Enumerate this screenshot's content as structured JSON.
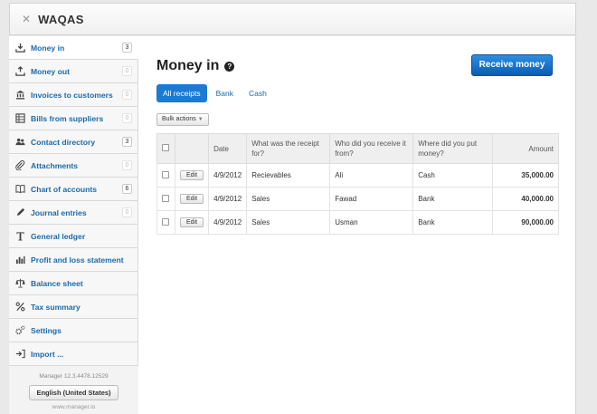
{
  "header": {
    "title": "WAQAS"
  },
  "sidebar": {
    "items": [
      {
        "label": "Money in",
        "count": "3",
        "icon": "download-tray-icon",
        "active": true
      },
      {
        "label": "Money out",
        "count": "0",
        "icon": "upload-tray-icon"
      },
      {
        "label": "Invoices to customers",
        "count": "0",
        "icon": "bank-icon"
      },
      {
        "label": "Bills from suppliers",
        "count": "0",
        "icon": "spreadsheet-icon"
      },
      {
        "label": "Contact directory",
        "count": "3",
        "icon": "people-icon"
      },
      {
        "label": "Attachments",
        "count": "0",
        "icon": "paperclip-icon"
      },
      {
        "label": "Chart of accounts",
        "count": "6",
        "icon": "book-icon"
      },
      {
        "label": "Journal entries",
        "count": "0",
        "icon": "pencil-icon"
      },
      {
        "label": "General ledger",
        "count": "",
        "icon": "letter-t-icon"
      },
      {
        "label": "Profit and loss statement",
        "count": "",
        "icon": "bar-chart-icon"
      },
      {
        "label": "Balance sheet",
        "count": "",
        "icon": "scale-icon"
      },
      {
        "label": "Tax summary",
        "count": "",
        "icon": "percent-icon"
      },
      {
        "label": "Settings",
        "count": "",
        "icon": "gears-icon"
      },
      {
        "label": "Import ...",
        "count": "",
        "icon": "import-icon"
      }
    ],
    "version": "Manager 12.3.4478.12529",
    "language": "English (United States)",
    "site": "www.manager.io"
  },
  "main": {
    "title": "Money in",
    "receive_label": "Receive money",
    "tabs": [
      {
        "label": "All receipts",
        "active": true
      },
      {
        "label": "Bank"
      },
      {
        "label": "Cash"
      }
    ],
    "bulk_label": "Bulk actions",
    "columns": {
      "date": "Date",
      "receipt_for": "What was the receipt for?",
      "received_from": "Who did you receive it from?",
      "put_money": "Where did you put money?",
      "amount": "Amount"
    },
    "edit_label": "Edit",
    "rows": [
      {
        "date": "4/9/2012",
        "for": "Recievables",
        "from": "Ali",
        "where": "Cash",
        "amount": "35,000.00"
      },
      {
        "date": "4/9/2012",
        "for": "Sales",
        "from": "Fawad",
        "where": "Bank",
        "amount": "40,000.00"
      },
      {
        "date": "4/9/2012",
        "for": "Sales",
        "from": "Usman",
        "where": "Bank",
        "amount": "90,000.00"
      }
    ]
  }
}
